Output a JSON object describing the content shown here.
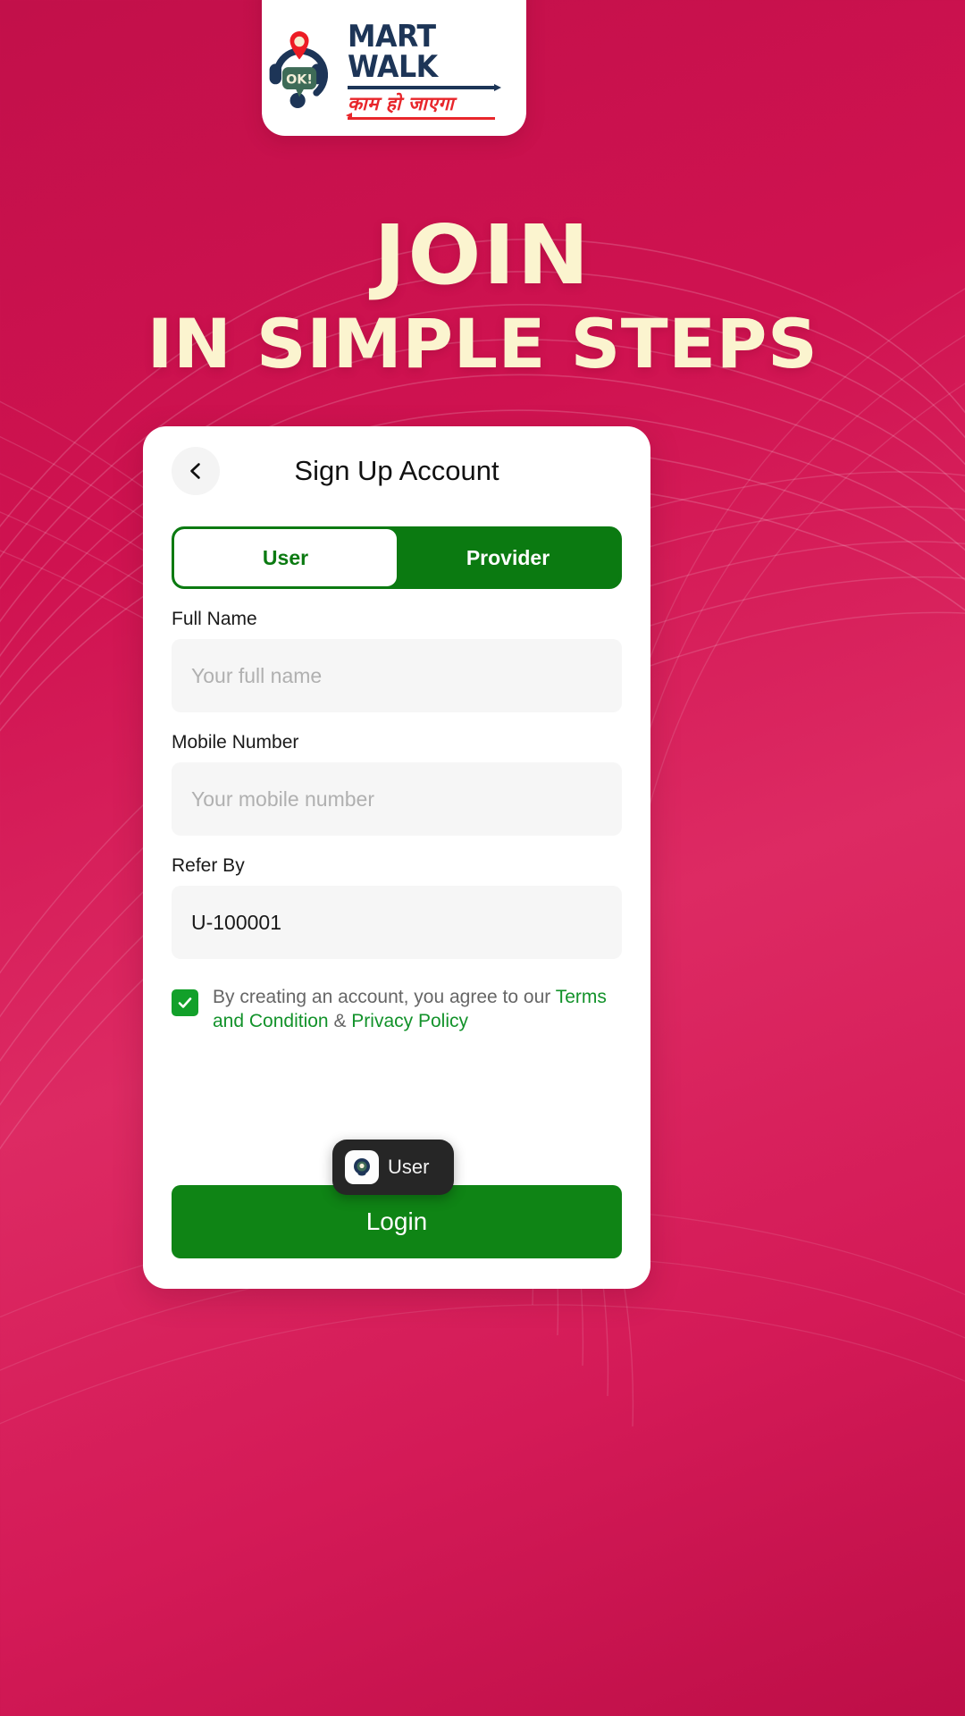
{
  "brand": {
    "logo_title": "MART WALK",
    "logo_tagline": "काम हो जाएगा",
    "logo_badge_text": "OK!"
  },
  "hero": {
    "line1": "JOIN",
    "line2": "IN SIMPLE STEPS"
  },
  "card": {
    "title": "Sign Up Account",
    "back_icon": "chevron-left-icon"
  },
  "tabs": [
    {
      "label": "User",
      "active": true
    },
    {
      "label": "Provider",
      "active": false
    }
  ],
  "form": {
    "full_name": {
      "label": "Full Name",
      "placeholder": "Your full name",
      "value": ""
    },
    "mobile_number": {
      "label": "Mobile Number",
      "placeholder": "Your mobile number",
      "value": ""
    },
    "refer_by": {
      "label": "Refer By",
      "placeholder": "",
      "value": "U-100001"
    }
  },
  "terms": {
    "checked": true,
    "prefix": "By creating an account, you agree to our ",
    "link_terms": "Terms and Condition",
    "separator": " & ",
    "link_privacy": "Privacy Policy"
  },
  "autofill_pill": {
    "label": "User",
    "icon": "app-logo-icon"
  },
  "actions": {
    "login_label": "Login"
  },
  "colors": {
    "background_top": "#C2104A",
    "background_bottom": "#BD0E47",
    "hero_text": "#FBF4CF",
    "accent_green": "#0B7A11",
    "button_green": "#0F8415",
    "link_green": "#12922A",
    "logo_navy": "#1D3557",
    "logo_red": "#E8262B",
    "field_bg": "#F6F6F6"
  }
}
